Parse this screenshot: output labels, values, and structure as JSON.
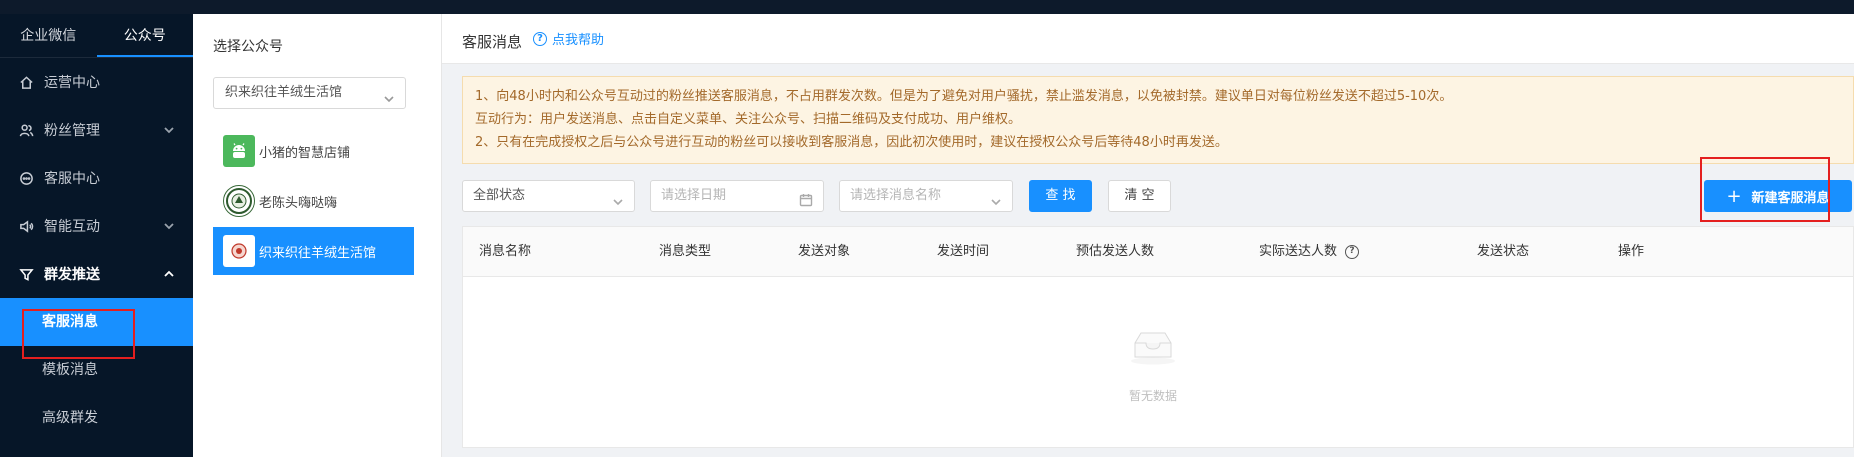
{
  "sidebar": {
    "tabs": [
      "企业微信",
      "公众号"
    ],
    "items": [
      {
        "label": "运营中心",
        "icon": "home-icon"
      },
      {
        "label": "粉丝管理",
        "icon": "users-icon"
      },
      {
        "label": "客服中心",
        "icon": "chat-icon"
      },
      {
        "label": "智能互动",
        "icon": "speaker-icon"
      },
      {
        "label": "群发推送",
        "icon": "funnel-icon"
      }
    ],
    "subitems": [
      "客服消息",
      "模板消息",
      "高级群发"
    ]
  },
  "account_panel": {
    "title": "选择公众号",
    "selected": "织来织往羊绒生活馆",
    "accounts": [
      "小猪的智慧店铺",
      "老陈头嗨哒嗨",
      "织来织往羊绒生活馆"
    ]
  },
  "header": {
    "title": "客服消息",
    "help": "点我帮助"
  },
  "notice": {
    "line1": "1、向48小时内和公众号互动过的粉丝推送客服消息，不占用群发次数。但是为了避免对用户骚扰，禁止滥发消息，以免被封禁。建议单日对每位粉丝发送不超过5-10次。",
    "line2": "互动行为：用户发送消息、点击自定义菜单、关注公众号、扫描二维码及支付成功、用户维权。",
    "line3": "2、只有在完成授权之后与公众号进行互动的粉丝可以接收到客服消息，因此初次使用时，建议在授权公众号后等待48小时再发送。"
  },
  "filters": {
    "status": "全部状态",
    "date_placeholder": "请选择日期",
    "name_placeholder": "请选择消息名称",
    "search": "查 找",
    "clear": "清 空",
    "new_button": "新建客服消息"
  },
  "table": {
    "columns": [
      "消息名称",
      "消息类型",
      "发送对象",
      "发送时间",
      "预估发送人数",
      "实际送达人数",
      "发送状态",
      "操作"
    ],
    "empty_text": "暂无数据"
  },
  "colors": {
    "accent": "#1890ff",
    "sidebar_bg": "#061628",
    "highlight_box": "#e41f1f",
    "notice_bg": "#fdf4e3"
  }
}
